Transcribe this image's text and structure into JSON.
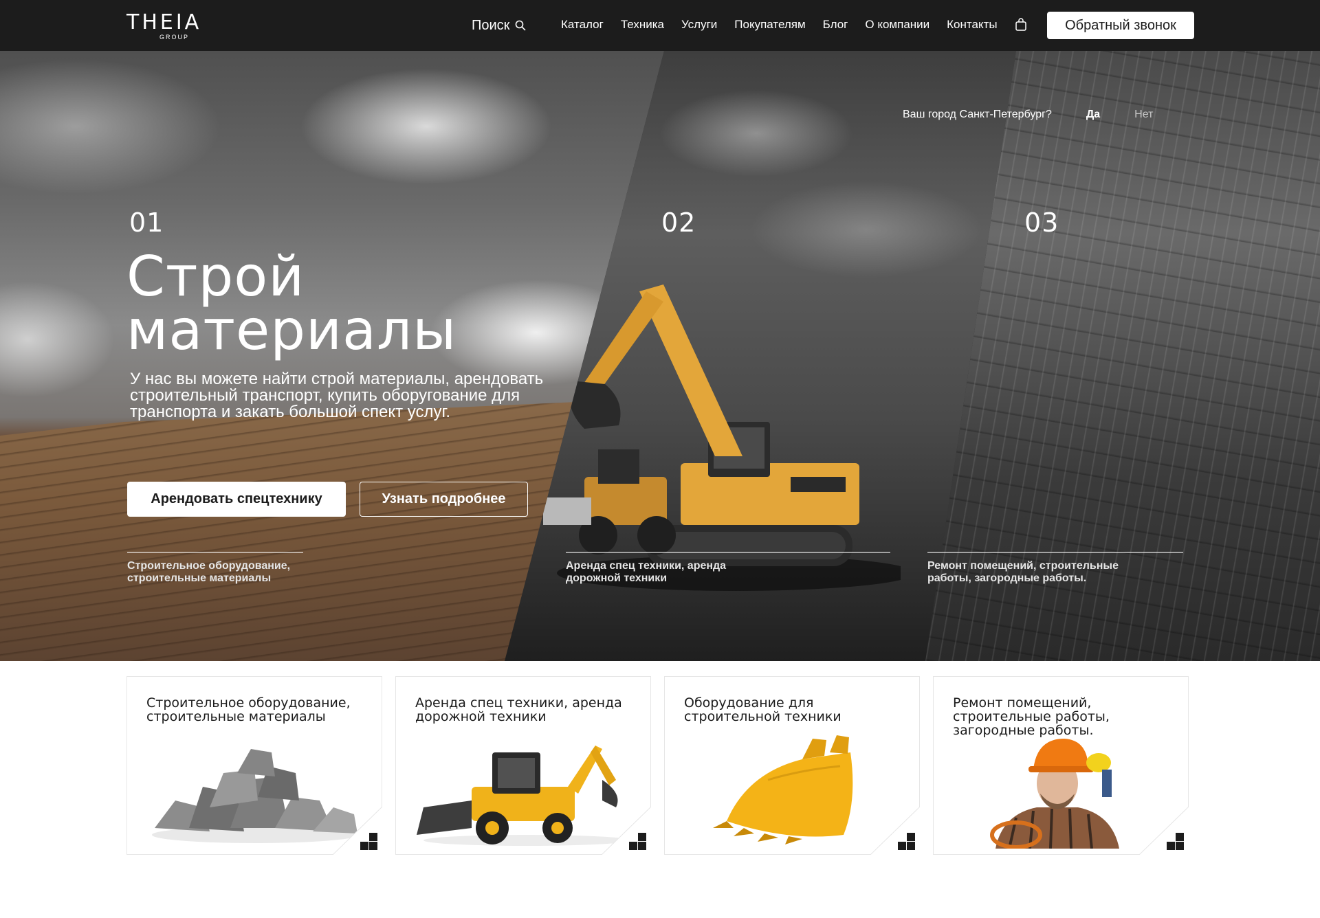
{
  "header": {
    "logo": "THEIA",
    "logo_sub": "GROUP",
    "search_label": "Поиск",
    "nav": [
      "Каталог",
      "Техника",
      "Услуги",
      "Покупателям",
      "Блог",
      "О компании",
      "Контакты"
    ],
    "callback_label": "Обратный звонок"
  },
  "city": {
    "question": "Ваш город Санкт-Петербург?",
    "yes": "Да",
    "no": "Нет"
  },
  "hero": {
    "numbers": [
      "01",
      "02",
      "03"
    ],
    "title_line1": "Строй",
    "title_line2": "материалы",
    "description": "У нас вы можете найти строй материалы, арендовать строительный транспорт, купить оборугование для транспорта и закать большой спект услуг.",
    "btn_primary": "Арендовать спецтехнику",
    "btn_outline": "Узнать подробнее",
    "captions": [
      "Строительное оборудование, строительные материалы",
      "Аренда  спец техники, аренда дорожной техники",
      "Ремонт помещений, строительные работы, загородные работы."
    ]
  },
  "cards": [
    {
      "title": "Строительное оборудование, строительные материалы",
      "icon": "stones-image"
    },
    {
      "title": "Аренда  спец техники, аренда дорожной техники",
      "icon": "backhoe-loader-image"
    },
    {
      "title": "Оборудование для строительной техники",
      "icon": "excavator-bucket-image"
    },
    {
      "title": "Ремонт помещений, строительные работы, загородные работы.",
      "icon": "worker-image"
    }
  ],
  "colors": {
    "header_bg": "#1c1c1c",
    "accent_yellow": "#f2b21c",
    "text_dark": "#1c1c1c"
  }
}
